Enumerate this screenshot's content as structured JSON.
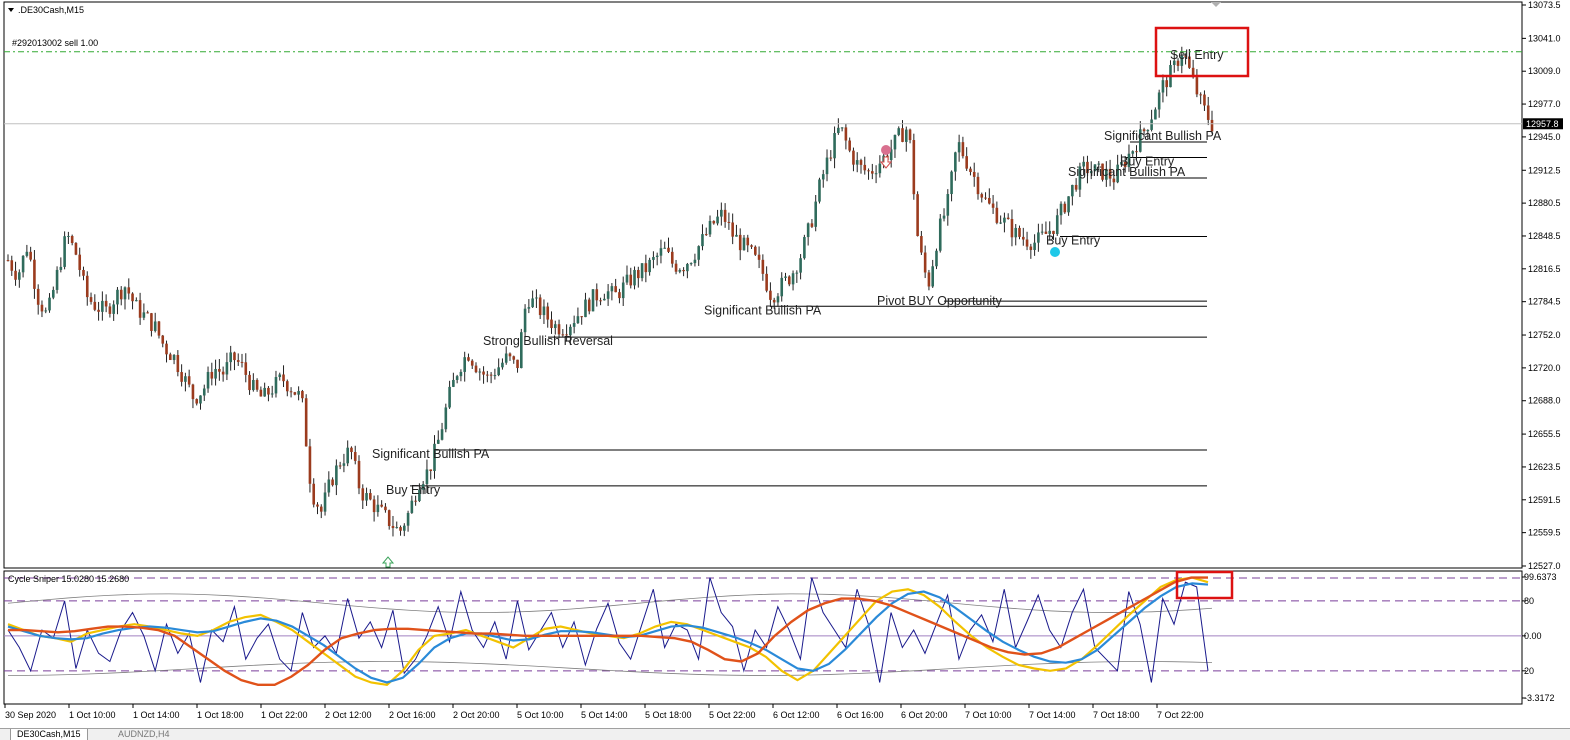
{
  "window": {
    "symbol_title": ".DE30Cash,M15",
    "order_line_label": "#292013002 sell 1.00",
    "current_price": "12957.8"
  },
  "price_axis": {
    "labels": [
      "13073.5",
      "13041.0",
      "13009.0",
      "12977.0",
      "12945.0",
      "12912.5",
      "12880.5",
      "12848.5",
      "12816.5",
      "12784.5",
      "12752.0",
      "12720.0",
      "12688.0",
      "12655.5",
      "12623.5",
      "12591.5",
      "12559.5",
      "12527.0"
    ]
  },
  "indicator": {
    "title": "Cycle Sniper 15.0280 15.2680",
    "axis_labels": [
      "99.6373",
      "80",
      "0.00",
      "20",
      "-3.3172"
    ]
  },
  "time_axis": {
    "labels": [
      "30 Sep 2020",
      "1 Oct 10:00",
      "1 Oct 14:00",
      "1 Oct 18:00",
      "1 Oct 22:00",
      "2 Oct 12:00",
      "2 Oct 16:00",
      "2 Oct 20:00",
      "5 Oct 10:00",
      "5 Oct 14:00",
      "5 Oct 18:00",
      "5 Oct 22:00",
      "6 Oct 12:00",
      "6 Oct 16:00",
      "6 Oct 20:00",
      "7 Oct 10:00",
      "7 Oct 14:00",
      "7 Oct 18:00",
      "7 Oct 22:00"
    ]
  },
  "tabs": [
    "DE30Cash,M15",
    "AUDNZD,H4"
  ],
  "annotations": [
    {
      "text": "Sell Entry"
    },
    {
      "text": "Significant Bullish PA"
    },
    {
      "text": "Buy Entry"
    },
    {
      "text": "Significant Bullish PA"
    },
    {
      "text": "Buy Entry"
    },
    {
      "text": "Pivot BUY Opportunity"
    },
    {
      "text": "Significant Bullish PA"
    },
    {
      "text": "Strong Bullish Reversal"
    },
    {
      "text": "Significant Bullish PA"
    },
    {
      "text": "Buy Entry"
    }
  ],
  "colors": {
    "bull_candle": "#2f6b5c",
    "bear_candle": "#9b3b1e",
    "order_line": "#33aa33",
    "highlight_box": "#dd1111",
    "osc_navy": "#1a1a8c",
    "osc_yellow": "#f2c200",
    "osc_blue": "#2a8ad8",
    "osc_orange": "#e0521a",
    "osc_band": "#808080",
    "level_dash": "#7a3f9a"
  },
  "chart_data": [
    {
      "type": "candlestick",
      "title": ".DE30Cash,M15",
      "ylim": [
        12527.0,
        13073.5
      ],
      "x_tick_labels": [
        "30 Sep 2020",
        "1 Oct 10:00",
        "1 Oct 14:00",
        "1 Oct 18:00",
        "1 Oct 22:00",
        "2 Oct 12:00",
        "2 Oct 16:00",
        "2 Oct 20:00",
        "5 Oct 10:00",
        "5 Oct 14:00",
        "5 Oct 18:00",
        "5 Oct 22:00",
        "6 Oct 12:00",
        "6 Oct 16:00",
        "6 Oct 20:00",
        "7 Oct 10:00",
        "7 Oct 14:00",
        "7 Oct 18:00",
        "7 Oct 22:00"
      ],
      "close_path": [
        12825,
        12810,
        12840,
        12790,
        12770,
        12810,
        12850,
        12830,
        12790,
        12780,
        12775,
        12790,
        12800,
        12780,
        12770,
        12760,
        12740,
        12730,
        12710,
        12690,
        12700,
        12720,
        12715,
        12730,
        12720,
        12700,
        12690,
        12700,
        12710,
        12700,
        12690,
        12600,
        12580,
        12610,
        12630,
        12640,
        12600,
        12590,
        12580,
        12570,
        12560,
        12580,
        12610,
        12620,
        12650,
        12690,
        12720,
        12735,
        12720,
        12710,
        12720,
        12730,
        12720,
        12790,
        12780,
        12770,
        12760,
        12760,
        12770,
        12780,
        12790,
        12795,
        12790,
        12800,
        12810,
        12815,
        12825,
        12835,
        12820,
        12820,
        12830,
        12845,
        12860,
        12870,
        12850,
        12840,
        12830,
        12815,
        12790,
        12800,
        12810,
        12830,
        12860,
        12900,
        12930,
        12955,
        12930,
        12915,
        12910,
        12920,
        12930,
        12945,
        12955,
        12840,
        12800,
        12850,
        12880,
        12940,
        12920,
        12900,
        12880,
        12870,
        12860,
        12850,
        12845,
        12842,
        12850,
        12860,
        12880,
        12900,
        12915,
        12912,
        12910,
        12905,
        12920,
        12935,
        12950,
        12970,
        12995,
        13010,
        13030,
        13000,
        12975,
        12957
      ],
      "levels": [
        {
          "name": "Sell Entry",
          "value": 13020
        },
        {
          "name": "Significant Bullish PA",
          "value": 12940
        },
        {
          "name": "Buy Entry",
          "value": 12925
        },
        {
          "name": "Significant Bullish PA",
          "value": 12905
        },
        {
          "name": "Buy Entry",
          "value": 12848
        },
        {
          "name": "Pivot BUY Opportunity",
          "value": 12785
        },
        {
          "name": "Significant Bullish PA",
          "value": 12780
        },
        {
          "name": "Strong Bullish Reversal",
          "value": 12750
        },
        {
          "name": "Significant Bullish PA",
          "value": 12640
        },
        {
          "name": "Buy Entry",
          "value": 12605
        }
      ],
      "order_line": {
        "label": "#292013002 sell 1.00",
        "value": 13028
      },
      "current_price": 12957.8
    },
    {
      "type": "line",
      "title": "Cycle Sniper 15.0280 15.2680",
      "ylim": [
        -3.3172,
        99.6373
      ],
      "levels": [
        80,
        20,
        0
      ],
      "series": [
        {
          "key": "navy",
          "values": [
            55,
            40,
            20,
            55,
            48,
            80,
            22,
            55,
            35,
            28,
            55,
            70,
            50,
            20,
            60,
            35,
            52,
            10,
            55,
            45,
            75,
            30,
            48,
            60,
            30,
            20,
            70,
            40,
            50,
            35,
            82,
            48,
            62,
            40,
            72,
            18,
            30,
            50,
            75,
            45,
            88,
            55,
            40,
            62,
            30,
            80,
            38,
            54,
            70,
            40,
            62,
            25,
            56,
            78,
            44,
            30,
            60,
            90,
            40,
            60,
            55,
            30,
            100,
            70,
            58,
            20,
            55,
            40,
            75,
            55,
            30,
            100,
            70,
            55,
            40,
            90,
            60,
            10,
            70,
            40,
            55,
            35,
            60,
            85,
            30,
            55,
            68,
            45,
            90,
            40,
            62,
            85,
            55,
            40,
            70,
            90,
            40,
            30,
            20,
            88,
            60,
            10,
            82,
            60,
            96,
            92,
            20
          ]
        },
        {
          "key": "yellow",
          "values": [
            60,
            55,
            50,
            48,
            45,
            52,
            55,
            58,
            60,
            58,
            55,
            52,
            50,
            55,
            62,
            66,
            68,
            62,
            55,
            45,
            35,
            25,
            15,
            10,
            8,
            20,
            38,
            50,
            52,
            55,
            50,
            45,
            40,
            48,
            56,
            58,
            55,
            52,
            50,
            48,
            52,
            58,
            62,
            60,
            55,
            50,
            45,
            40,
            32,
            20,
            12,
            20,
            35,
            50,
            65,
            80,
            88,
            90,
            85,
            75,
            62,
            50,
            40,
            32,
            25,
            22,
            20,
            22,
            30,
            42,
            55,
            68,
            80,
            92,
            98,
            100,
            96
          ]
        },
        {
          "key": "blue",
          "values": [
            58,
            54,
            50,
            48,
            47,
            48,
            52,
            55,
            57,
            58,
            57,
            55,
            53,
            54,
            58,
            62,
            65,
            63,
            58,
            50,
            42,
            32,
            22,
            14,
            10,
            14,
            26,
            40,
            48,
            52,
            52,
            49,
            46,
            47,
            51,
            54,
            54,
            53,
            51,
            49,
            50,
            54,
            58,
            59,
            57,
            53,
            49,
            44,
            38,
            30,
            22,
            20,
            26,
            38,
            52,
            66,
            78,
            86,
            88,
            83,
            74,
            64,
            54,
            45,
            38,
            32,
            28,
            27,
            30,
            38,
            50,
            62,
            74,
            84,
            92,
            95,
            94
          ]
        },
        {
          "key": "orange",
          "values": [
            55,
            55,
            54,
            53,
            54,
            56,
            58,
            58,
            57,
            55,
            50,
            40,
            30,
            20,
            12,
            8,
            8,
            15,
            25,
            38,
            48,
            52,
            55,
            56,
            56,
            55,
            54,
            53,
            52,
            52,
            51,
            50,
            50,
            50,
            50,
            50,
            50,
            50,
            50,
            49,
            48,
            45,
            38,
            30,
            28,
            35,
            50,
            62,
            72,
            78,
            82,
            82,
            80,
            76,
            70,
            64,
            58,
            52,
            46,
            40,
            36,
            34,
            35,
            40,
            48,
            56,
            64,
            72,
            80,
            88,
            96,
            100,
            100
          ]
        }
      ]
    }
  ]
}
